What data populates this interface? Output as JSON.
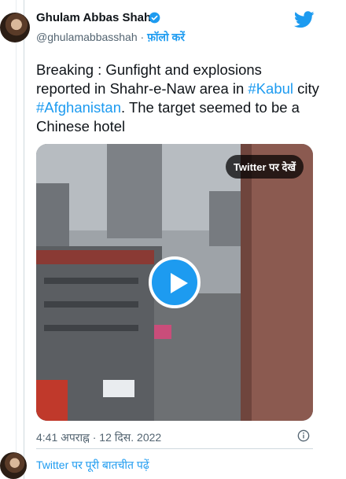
{
  "tweet": {
    "author_name": "Ghulam Abbas Shah",
    "handle": "@ghulamabbasshah",
    "separator": "·",
    "follow_label": "फ़ॉलो करें",
    "text_parts": [
      {
        "t": "Breaking : Gunfight and explosions reported in Shahr-e-Naw area in ",
        "tag": false
      },
      {
        "t": "#Kabul",
        "tag": true
      },
      {
        "t": " city ",
        "tag": false
      },
      {
        "t": "#Afghanistan",
        "tag": true
      },
      {
        "t": ".  The target seemed to be a Chinese hotel",
        "tag": false
      }
    ],
    "watch_on_twitter": "Twitter पर देखें",
    "timestamp": "4:41 अपराह्न · 12 दिस. 2022",
    "read_conversation": "Twitter पर पूरी बातचीत पढ़ें"
  },
  "icons": {
    "verified": "verified-badge-icon",
    "brand": "twitter-bird-icon",
    "play": "play-icon",
    "info": "info-icon"
  },
  "colors": {
    "accent": "#1d9bf0",
    "text": "#0f1419",
    "muted": "#536471"
  }
}
